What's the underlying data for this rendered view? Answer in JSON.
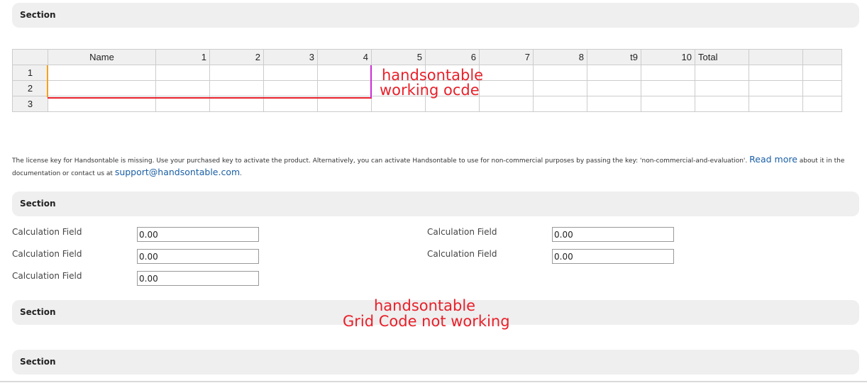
{
  "sections": {
    "s1": "Section",
    "s2": "Section",
    "s3": "Section",
    "s4": "Section"
  },
  "grid": {
    "headers": [
      "Name",
      "1",
      "2",
      "3",
      "4",
      "5",
      "6",
      "7",
      "8",
      "t9",
      "10",
      "Total",
      "",
      ""
    ],
    "rows": [
      "1",
      "2",
      "3"
    ]
  },
  "annotations": {
    "working_1": "handsontable",
    "working_2": "working ocde",
    "broken_1": "handsontable",
    "broken_2": "Grid Code not working"
  },
  "license": {
    "text_a": "The license key for Handsontable is missing. Use your purchased key to activate the product. Alternatively, you can activate Handsontable to use for non-commercial purposes by passing the key: 'non-commercial-and-evaluation'.",
    "read_more": "Read more",
    "text_b": "about it in the documentation or contact us at",
    "email": "support@handsontable.com",
    "text_c": "."
  },
  "fields": [
    {
      "label": "Calculation Field",
      "value": "0.00"
    },
    {
      "label": "Calculation Field",
      "value": "0.00"
    },
    {
      "label": "Calculation Field",
      "value": "0.00"
    },
    {
      "label": "Calculation Field",
      "value": "0.00"
    },
    {
      "label": "Calculation Field",
      "value": "0.00"
    }
  ]
}
